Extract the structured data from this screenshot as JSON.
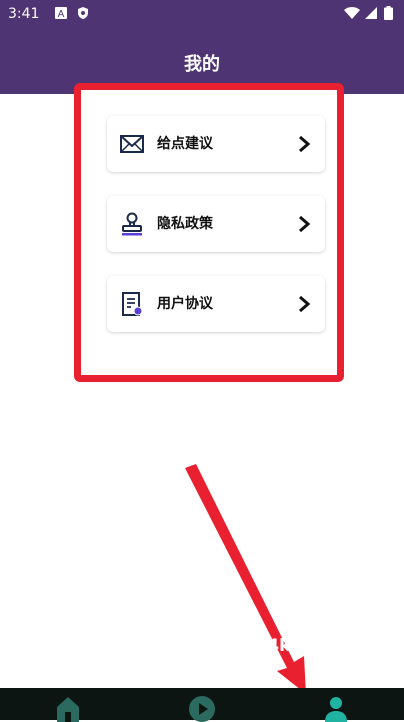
{
  "status_bar": {
    "time": "3:41",
    "icons": [
      "notification-a-icon",
      "shield-icon",
      "wifi-icon",
      "signal-icon",
      "battery-icon"
    ]
  },
  "header": {
    "title": "我的",
    "background": "#4e3472"
  },
  "menu": {
    "items": [
      {
        "label": "给点建议",
        "icon": "envelope-icon"
      },
      {
        "label": "隐私政策",
        "icon": "stamp-icon"
      },
      {
        "label": "用户协议",
        "icon": "document-icon"
      }
    ]
  },
  "annotation": {
    "highlight_color": "#e8202f",
    "watermark": "k4k"
  },
  "bottom_nav": {
    "items": [
      {
        "icon": "home-icon"
      },
      {
        "icon": "play-icon"
      },
      {
        "icon": "user-icon",
        "active": true
      }
    ],
    "active_color": "#20b3a2"
  }
}
